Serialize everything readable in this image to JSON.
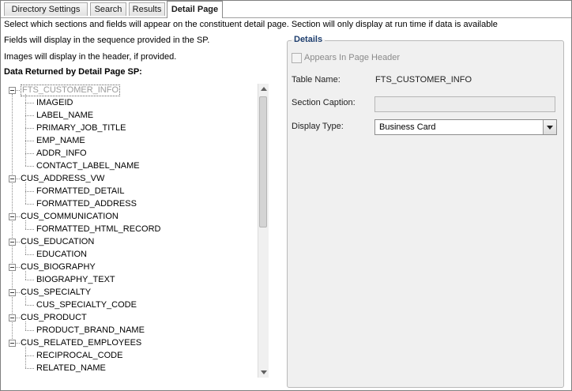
{
  "tabs": [
    {
      "label": "Directory Settings",
      "active": false
    },
    {
      "label": "Search",
      "active": false
    },
    {
      "label": "Results",
      "active": false
    },
    {
      "label": "Detail Page",
      "active": true
    }
  ],
  "instructions": {
    "line1": "Select which sections and fields will appear on the constituent detail page. Section will only display at run time if data is available",
    "line2": "Fields will display in the sequence provided in the SP.",
    "line3": "Images will display in the header, if provided."
  },
  "tree": {
    "heading": "Data Returned by Detail Page SP:",
    "sections": [
      {
        "label": "FTS_CUSTOMER_INFO",
        "fields": [
          "IMAGEID",
          "LABEL_NAME",
          "PRIMARY_JOB_TITLE",
          "EMP_NAME",
          "ADDR_INFO",
          "CONTACT_LABEL_NAME"
        ]
      },
      {
        "label": "CUS_ADDRESS_VW",
        "fields": [
          "FORMATTED_DETAIL",
          "FORMATTED_ADDRESS"
        ]
      },
      {
        "label": "CUS_COMMUNICATION",
        "fields": [
          "FORMATTED_HTML_RECORD"
        ]
      },
      {
        "label": "CUS_EDUCATION",
        "fields": [
          "EDUCATION"
        ]
      },
      {
        "label": "CUS_BIOGRAPHY",
        "fields": [
          "BIOGRAPHY_TEXT"
        ]
      },
      {
        "label": "CUS_SPECIALTY",
        "fields": [
          "CUS_SPECIALTY_CODE"
        ]
      },
      {
        "label": "CUS_PRODUCT",
        "fields": [
          "PRODUCT_BRAND_NAME"
        ]
      },
      {
        "label": "CUS_RELATED_EMPLOYEES",
        "fields": [
          "RECIPROCAL_CODE",
          "RELATED_NAME"
        ]
      }
    ]
  },
  "details": {
    "legend": "Details",
    "appears_in_header_label": "Appears In Page Header",
    "table_name_label": "Table Name:",
    "table_name_value": "FTS_CUSTOMER_INFO",
    "section_caption_label": "Section Caption:",
    "section_caption_value": "",
    "display_type_label": "Display Type:",
    "display_type_value": "Business Card"
  }
}
